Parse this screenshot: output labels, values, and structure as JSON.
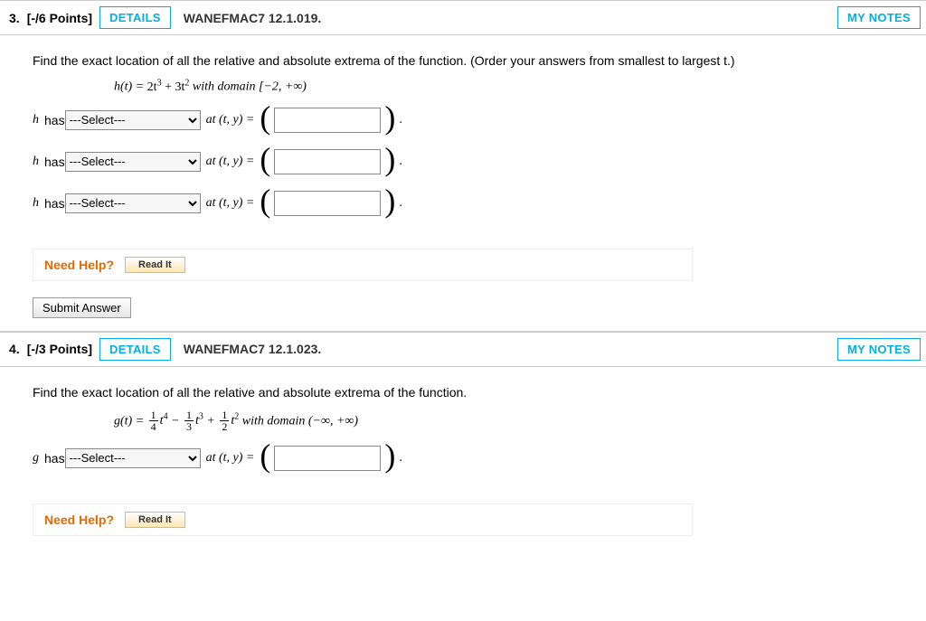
{
  "questions": [
    {
      "number": "3.",
      "points": "[-/6 Points]",
      "details": "DETAILS",
      "ref": "WANEFMAC7 12.1.019.",
      "mynotes": "MY NOTES",
      "prompt": "Find the exact location of all the relative and absolute extrema of the function. (Order your answers from smallest to largest t.)",
      "formula_lhs": "h(t) = ",
      "formula_rhs_a": "2t",
      "formula_exp1": "3",
      "formula_plus": " + 3t",
      "formula_exp2": "2",
      "formula_domain": " with domain [−2, +∞)",
      "rows": [
        {
          "fn": "h",
          "has": " has ",
          "select": "---Select---",
          "atxy": " at (t, y) = "
        },
        {
          "fn": "h",
          "has": " has ",
          "select": "---Select---",
          "atxy": " at (t, y) = "
        },
        {
          "fn": "h",
          "has": " has ",
          "select": "---Select---",
          "atxy": " at (t, y) = "
        }
      ],
      "need_help": "Need Help?",
      "read_it": "Read It",
      "submit": "Submit Answer"
    },
    {
      "number": "4.",
      "points": "[-/3 Points]",
      "details": "DETAILS",
      "ref": "WANEFMAC7 12.1.023.",
      "mynotes": "MY NOTES",
      "prompt": "Find the exact location of all the relative and absolute extrema of the function.",
      "formula_lhs": "g(t) = ",
      "term1_exp": "4",
      "minus": " − ",
      "term2_exp": "3",
      "plus": " + ",
      "term3_exp": "2",
      "formula_domain": " with domain (−∞, +∞)",
      "rows": [
        {
          "fn": "g",
          "has": " has ",
          "select": "---Select---",
          "atxy": " at (t, y) = "
        }
      ],
      "need_help": "Need Help?",
      "read_it": "Read It"
    }
  ],
  "t_var": "t",
  "fracs": {
    "one": "1",
    "four": "4",
    "three": "3",
    "two": "2"
  }
}
